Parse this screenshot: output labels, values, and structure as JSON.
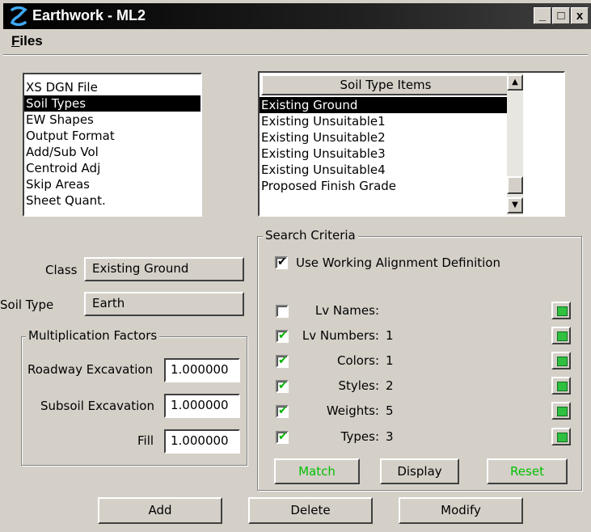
{
  "window": {
    "title": "Earthwork - ML2",
    "minimize_glyph": "_",
    "maximize_glyph": "□",
    "close_glyph": "x"
  },
  "menubar": {
    "files": {
      "first": "F",
      "rest": "iles"
    }
  },
  "nav_list": {
    "items": [
      "XS DGN File",
      "Soil Types",
      "EW Shapes",
      "Output Format",
      "Add/Sub Vol",
      "Centroid Adj",
      "Skip Areas",
      "Sheet Quant."
    ],
    "selected_index": 1
  },
  "soil_items": {
    "header": "Soil Type Items",
    "items": [
      "Existing Ground",
      "Existing Unsuitable1",
      "Existing Unsuitable2",
      "Existing Unsuitable3",
      "Existing Unsuitable4",
      "Proposed Finish Grade"
    ],
    "selected_index": 0
  },
  "form": {
    "class_label": "Class",
    "class_value": "Existing Ground",
    "soil_type_label": "Soil Type",
    "soil_type_value": "Earth"
  },
  "multiplication": {
    "title": "Multiplication Factors",
    "roadway_label": "Roadway Excavation",
    "roadway_value": "1.000000",
    "subsoil_label": "Subsoil Excavation",
    "subsoil_value": "1.000000",
    "fill_label": "Fill",
    "fill_value": "1.000000"
  },
  "search": {
    "title": "Search Criteria",
    "use_working_label": "Use Working Alignment Definition",
    "use_working_checked": true,
    "rows": [
      {
        "label": "Lv Names:",
        "value": "",
        "checked": false
      },
      {
        "label": "Lv Numbers:",
        "value": "1",
        "checked": true
      },
      {
        "label": "Colors:",
        "value": "1",
        "checked": true
      },
      {
        "label": "Styles:",
        "value": "2",
        "checked": true
      },
      {
        "label": "Weights:",
        "value": "5",
        "checked": true
      },
      {
        "label": "Types:",
        "value": "3",
        "checked": true
      }
    ],
    "match_label": "Match",
    "display_label": "Display",
    "reset_label": "Reset"
  },
  "buttons": {
    "add": "Add",
    "delete": "Delete",
    "modify": "Modify"
  },
  "colors": {
    "title_bar": "#000000",
    "dialog_face": "#d4d0c8",
    "check_green": "#00b400",
    "button_green_text": "#00c000",
    "selection": "#000000"
  },
  "icons": {
    "app": "earthwork-app-icon",
    "pick": "green-square-pick-icon",
    "scroll_up": "up-arrow-icon",
    "scroll_down": "down-arrow-icon"
  }
}
